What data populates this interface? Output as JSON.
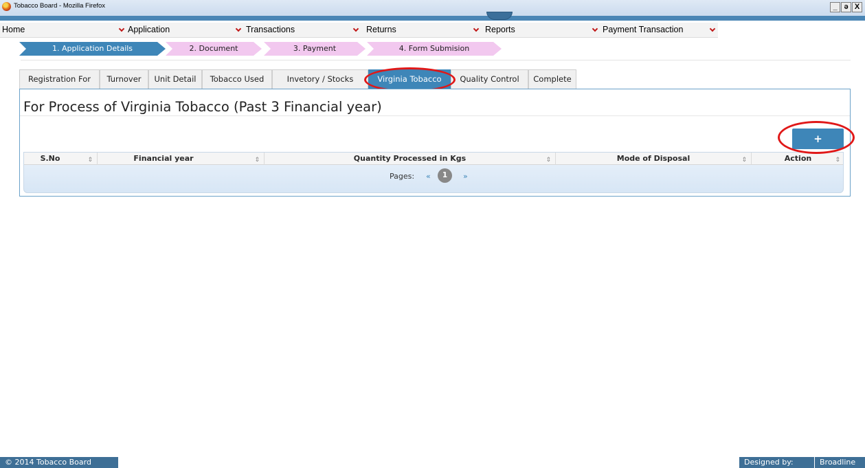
{
  "window": {
    "title": "Tobacco Board - Mozilla Firefox",
    "controls": [
      "_",
      "ə",
      "X"
    ]
  },
  "menu": [
    {
      "label": "Home"
    },
    {
      "label": "Application"
    },
    {
      "label": "Transactions"
    },
    {
      "label": "Returns"
    },
    {
      "label": "Reports"
    },
    {
      "label": "Payment Transaction"
    }
  ],
  "steps": [
    {
      "label": "1. Application Details",
      "state": "active"
    },
    {
      "label": "2. Document",
      "state": "pending"
    },
    {
      "label": "3. Payment",
      "state": "pending"
    },
    {
      "label": "4. Form Submision",
      "state": "pending"
    }
  ],
  "tabs": [
    {
      "label": "Registration For"
    },
    {
      "label": "Turnover"
    },
    {
      "label": "Unit Detail"
    },
    {
      "label": "Tobacco Used"
    },
    {
      "label": "Invetory / Stocks"
    },
    {
      "label": "Virginia Tobacco",
      "active": true
    },
    {
      "label": "Quality Control"
    },
    {
      "label": "Complete"
    }
  ],
  "panel": {
    "title": "For Process of Virginia Tobacco (Past 3 Financial year)",
    "add_label": "+"
  },
  "grid": {
    "columns": [
      "S.No",
      "Financial year",
      "Quantity Processed in Kgs",
      "Mode of Disposal",
      "Action"
    ],
    "pager": {
      "label": "Pages:",
      "prev": "«",
      "current": "1",
      "next": "»"
    }
  },
  "footer": {
    "copyright": "© 2014 Tobacco Board",
    "designed_by_label": "Designed by:",
    "designed_by_value": "Broadline"
  },
  "colors": {
    "accent": "#3e86b8",
    "step_pending": "#f2c8ef",
    "highlight": "#e01818"
  }
}
